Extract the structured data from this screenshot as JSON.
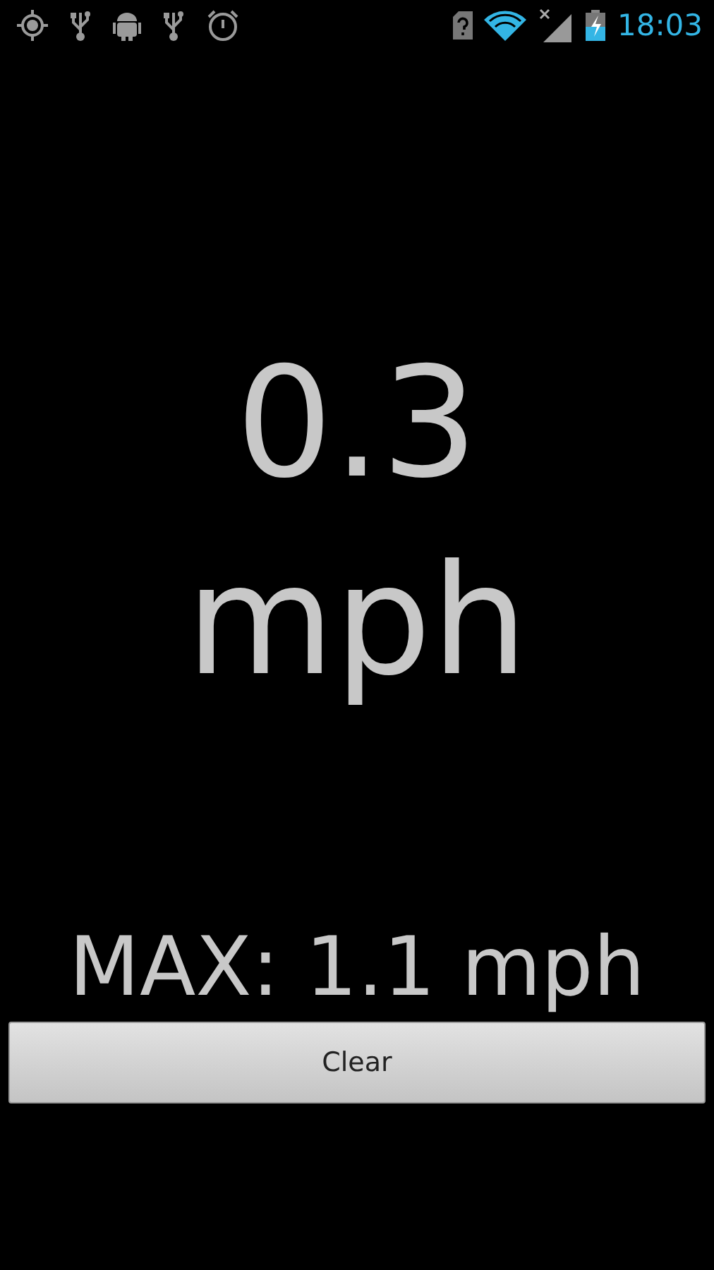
{
  "status_bar": {
    "time": "18:03"
  },
  "speed": {
    "value": "0.3",
    "unit": "mph"
  },
  "max": "MAX: 1.1 mph",
  "buttons": [
    "Clear"
  ]
}
